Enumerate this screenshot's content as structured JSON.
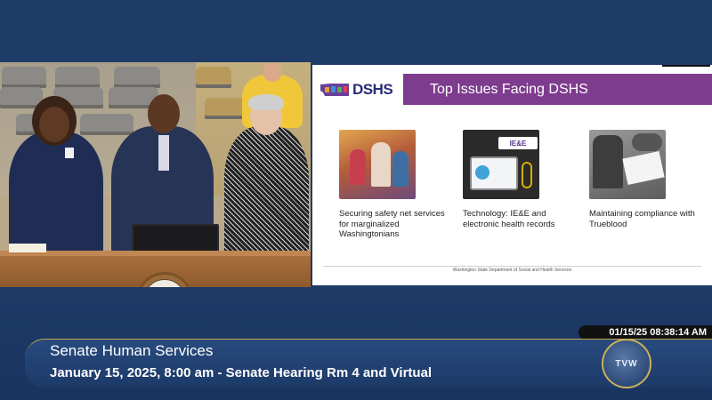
{
  "slide": {
    "logo_text": "DSHS",
    "title": "Top Issues Facing DSHS",
    "issues": [
      {
        "label": "Securing safety net services for marginalized Washingtonians"
      },
      {
        "label": "Technology: IE&E and electronic health records"
      },
      {
        "label": "Maintaining compliance with Trueblood"
      }
    ],
    "issue2_badge": "IE&E",
    "footer": "Washington State Department of Social and Health Services"
  },
  "timestamp": "01/15/25 08:38:14 AM",
  "lower_third": {
    "title": "Senate Human Services",
    "subtitle": "January 15, 2025, 8:00 am - Senate Hearing Rm 4 and Virtual"
  },
  "broadcaster": {
    "logo_text": "TVW"
  },
  "colors": {
    "background": "#1f3b67",
    "slide_title_bar": "#7e3c8e",
    "lower_third_accent": "#c7a64a"
  }
}
